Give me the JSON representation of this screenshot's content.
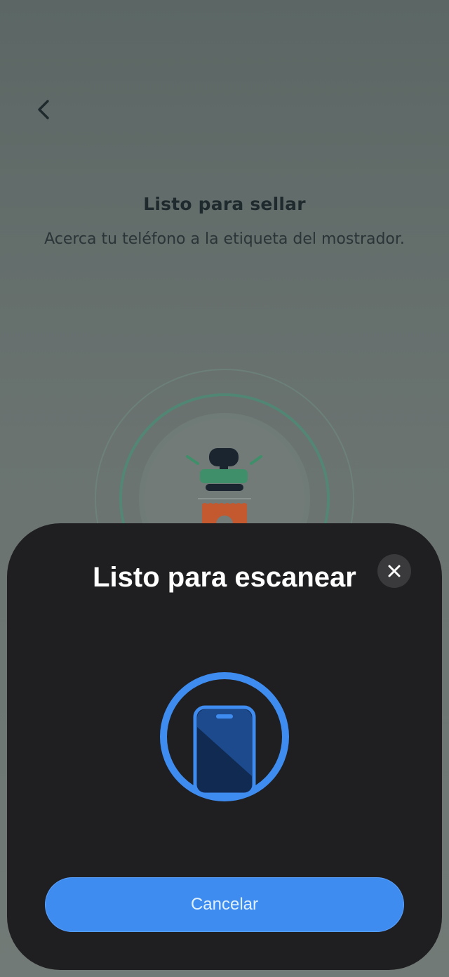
{
  "screen": {
    "title": "Listo para sellar",
    "subtitle": "Acerca tu teléfono a la etiqueta del mostrador.",
    "back_icon": "chevron-left-icon",
    "illustration": "stamp-icon"
  },
  "nfc_sheet": {
    "title": "Listo para escanear",
    "close_icon": "close-icon",
    "graphic": "phone-icon",
    "cancel_label": "Cancelar"
  },
  "colors": {
    "overlay_background": "#5f6a68",
    "sheet_background": "#1f1f21",
    "accent_blue": "#3f8cf0",
    "stamp_green": "#3f8f6a",
    "stamp_red": "#c4582f"
  }
}
